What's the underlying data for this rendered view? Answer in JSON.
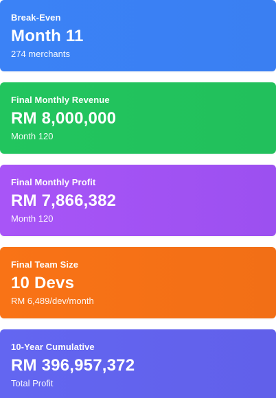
{
  "cards": [
    {
      "label": "Break-Even",
      "value": "Month 11",
      "sub": "274 merchants",
      "color": "#3b82f6"
    },
    {
      "label": "Final Monthly Revenue",
      "value": "RM 8,000,000",
      "sub": "Month 120",
      "color": "#22c55e"
    },
    {
      "label": "Final Monthly Profit",
      "value": "RM 7,866,382",
      "sub": "Month 120",
      "color": "#a855f7"
    },
    {
      "label": "Final Team Size",
      "value": "10 Devs",
      "sub": "RM 6,489/dev/month",
      "color": "#f97316"
    },
    {
      "label": "10-Year Cumulative",
      "value": "RM 396,957,372",
      "sub": "Total Profit",
      "color": "#6366f1"
    }
  ]
}
